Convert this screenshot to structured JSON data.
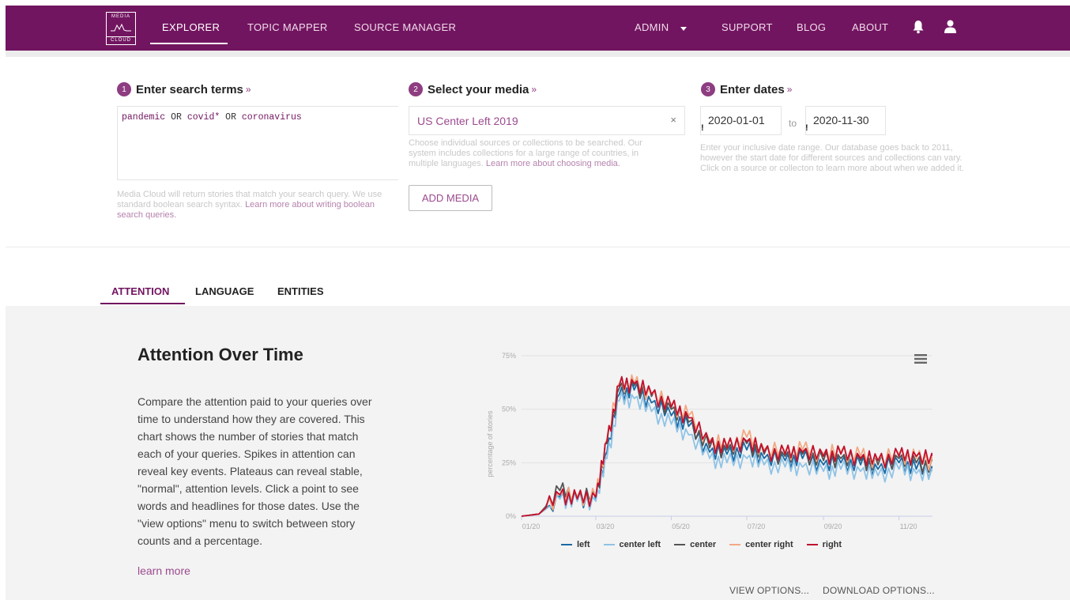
{
  "nav": {
    "logo_top": "MEDIA",
    "logo_bottom": "CLOUD",
    "items": [
      "EXPLORER",
      "TOPIC MAPPER",
      "SOURCE MANAGER"
    ],
    "admin": "ADMIN",
    "support": "SUPPORT",
    "blog": "BLOG",
    "about": "ABOUT",
    "accent": "#721560"
  },
  "search": {
    "step1": {
      "num": "1",
      "title": "Enter search terms",
      "raquo": "»"
    },
    "step2": {
      "num": "2",
      "title": "Select your media",
      "raquo": "»"
    },
    "step3": {
      "num": "3",
      "title": "Enter dates",
      "raquo": "»"
    },
    "query": {
      "t1": "pandemic",
      "op1": "OR",
      "t2": "covid*",
      "op2": "OR",
      "t3": "coronavirus"
    },
    "query_help": "Media Cloud will return stories that match your search query. We use standard boolean search syntax.",
    "query_help_link": "Learn more about writing boolean search queries.",
    "media_chip": "US Center Left 2019",
    "media_remove": "×",
    "media_help": "Choose individual sources or collections to be searched. Our system includes collections for a large range of countries, in multiple languages.",
    "media_help_link": "Learn more about choosing media.",
    "add_media": "ADD MEDIA",
    "date_bang": "!",
    "start_date": "2020-01-01",
    "date_to": "to",
    "end_date": "2020-11-30",
    "date_help": "Enter your inclusive date range. Our database goes back to 2011, however the start date for different sources and collections can vary. Click on a source or collecton to learn more about when we added it."
  },
  "tabs": [
    "ATTENTION",
    "LANGUAGE",
    "ENTITIES"
  ],
  "attention": {
    "title": "Attention Over Time",
    "description": "Compare the attention paid to your queries over time to understand how they are covered. This chart shows the number of stories that match each of your queries. Spikes in attention can reveal key events. Plateaus can reveal stable, \"normal\", attention levels. Click a point to see words and headlines for those dates. Use the \"view options\" menu to switch between story counts and a percentage.",
    "learn_more": "learn more",
    "view_options": "VIEW OPTIONS...",
    "download_options": "DOWNLOAD OPTIONS..."
  },
  "chart_data": {
    "type": "line",
    "title": "",
    "xlabel": "",
    "ylabel": "percentage of stories",
    "yticks": [
      "0%",
      "25%",
      "50%",
      "75%"
    ],
    "xticks": [
      "01/20",
      "03/20",
      "05/20",
      "07/20",
      "09/20",
      "11/20"
    ],
    "ylim": [
      0,
      75
    ],
    "grid": true,
    "legend_position": "bottom",
    "x": [
      "2020-01-01",
      "2020-01-15",
      "2020-02-01",
      "2020-02-15",
      "2020-03-01",
      "2020-03-10",
      "2020-03-20",
      "2020-04-01",
      "2020-04-15",
      "2020-05-01",
      "2020-05-15",
      "2020-06-01",
      "2020-06-15",
      "2020-07-01",
      "2020-07-15",
      "2020-08-01",
      "2020-08-15",
      "2020-09-01",
      "2020-09-15",
      "2020-10-01",
      "2020-10-15",
      "2020-11-01",
      "2020-11-15",
      "2020-11-30"
    ],
    "series": [
      {
        "name": "left",
        "color": "#1a6aa4",
        "values": [
          0,
          1,
          9,
          8,
          8,
          30,
          57,
          59,
          53,
          47,
          42,
          30,
          29,
          31,
          27,
          26,
          27,
          24,
          25,
          24,
          22,
          25,
          22,
          21
        ]
      },
      {
        "name": "center left",
        "color": "#8fc3e6",
        "values": [
          0,
          1,
          8,
          7,
          7,
          27,
          54,
          55,
          49,
          43,
          38,
          27,
          25,
          27,
          24,
          23,
          23,
          21,
          22,
          21,
          19,
          22,
          20,
          19
        ]
      },
      {
        "name": "center",
        "color": "#555555",
        "values": [
          0,
          1,
          12,
          9,
          9,
          34,
          60,
          61,
          56,
          50,
          44,
          32,
          31,
          34,
          29,
          28,
          29,
          26,
          27,
          26,
          24,
          27,
          25,
          23
        ]
      },
      {
        "name": "center right",
        "color": "#f3a882",
        "values": [
          0,
          1,
          10,
          9,
          9,
          36,
          62,
          62,
          57,
          52,
          47,
          35,
          33,
          37,
          31,
          30,
          31,
          29,
          30,
          28,
          26,
          29,
          27,
          25
        ]
      },
      {
        "name": "right",
        "color": "#c0102d",
        "values": [
          0,
          1,
          10,
          8,
          9,
          35,
          61,
          62,
          57,
          51,
          46,
          34,
          32,
          35,
          30,
          29,
          30,
          28,
          29,
          27,
          26,
          28,
          28,
          26
        ]
      }
    ]
  }
}
